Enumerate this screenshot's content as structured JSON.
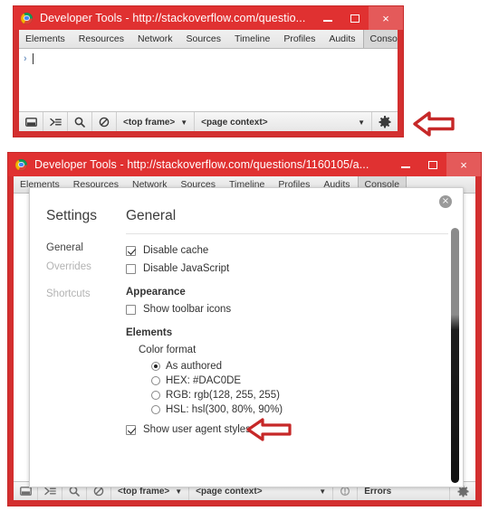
{
  "window_top": {
    "title": "Developer Tools - http://stackoverflow.com/questio...",
    "logo_icon": "chrome-logo-icon",
    "buttons": {
      "minimize": "minimize-icon",
      "maximize": "maximize-icon",
      "close": "×"
    },
    "tabs": [
      {
        "label": "Elements",
        "active": false
      },
      {
        "label": "Resources",
        "active": false
      },
      {
        "label": "Network",
        "active": false
      },
      {
        "label": "Sources",
        "active": false
      },
      {
        "label": "Timeline",
        "active": false
      },
      {
        "label": "Profiles",
        "active": false
      },
      {
        "label": "Audits",
        "active": false
      },
      {
        "label": "Console",
        "active": true
      }
    ],
    "console": {
      "prompt_chevron": "›",
      "input_value": ""
    },
    "statusbar": {
      "icons": [
        "dock-window-icon",
        "console-drawer-icon",
        "search-icon",
        "clear-console-icon"
      ],
      "frame_selector": "<top frame>",
      "context_selector": "<page context>",
      "dropdown_caret": "▼",
      "gear_icon": "gear-icon"
    },
    "annotation": {
      "arrow": "red-left-arrow-pointing-at-gear"
    }
  },
  "window_bottom": {
    "title": "Developer Tools - http://stackoverflow.com/questions/1160105/a...",
    "logo_icon": "chrome-logo-icon",
    "buttons": {
      "minimize": "minimize-icon",
      "maximize": "maximize-icon",
      "close": "×"
    },
    "statusbar": {
      "frame_selector": "<top frame>",
      "context_selector": "<page context>",
      "errors_label": "Errors",
      "dropdown_caret": "▼",
      "gear_icon": "gear-icon"
    },
    "settings": {
      "sidebar_title": "Settings",
      "nav": [
        {
          "label": "General",
          "active": true
        },
        {
          "label": "Overrides",
          "active": false
        },
        {
          "label": "Shortcuts",
          "active": false
        }
      ],
      "panel_title": "General",
      "close_icon": "×",
      "checkboxes_top": [
        {
          "label": "Disable cache",
          "checked": true
        },
        {
          "label": "Disable JavaScript",
          "checked": false
        }
      ],
      "appearance": {
        "heading": "Appearance",
        "options": [
          {
            "label": "Show toolbar icons",
            "checked": false
          }
        ]
      },
      "elements": {
        "heading": "Elements",
        "color_format_label": "Color format",
        "color_format_options": [
          {
            "label": "As authored",
            "selected": true
          },
          {
            "label": "HEX: #DAC0DE",
            "selected": false
          },
          {
            "label": "RGB: rgb(128, 255, 255)",
            "selected": false
          },
          {
            "label": "HSL: hsl(300, 80%, 90%)",
            "selected": false
          }
        ],
        "user_agent_styles": {
          "label": "Show user agent styles",
          "checked": true
        }
      },
      "annotation": {
        "arrow": "red-left-arrow-pointing-at-disable-cache"
      }
    }
  }
}
